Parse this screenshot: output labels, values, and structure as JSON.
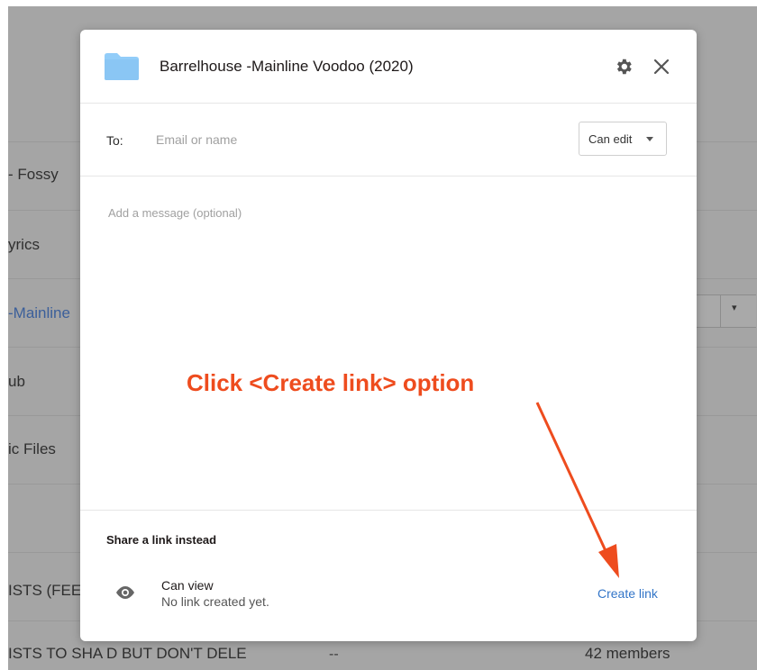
{
  "background": {
    "rows": [
      {
        "text": "- Fossy",
        "link": false
      },
      {
        "text": "yrics",
        "link": false
      },
      {
        "text": "-Mainline",
        "link": true
      },
      {
        "text": "ub",
        "link": false
      },
      {
        "text": "ic Files",
        "link": false
      },
      {
        "text": "",
        "link": false
      },
      {
        "text": "ISTS (FEE",
        "link": false
      },
      {
        "text": "ISTS TO SHA D BUT DON'T DELE",
        "link": false
      }
    ],
    "last_row_modified": "--",
    "last_row_members": "42 members",
    "dropdown_caret": "▾"
  },
  "dialog": {
    "title": "Barrelhouse -Mainline Voodoo (2020)",
    "to_label": "To:",
    "to_placeholder": "Email or name",
    "permission": "Can edit",
    "message_placeholder": "Add a message (optional)",
    "share_heading": "Share a link instead",
    "link_permission": "Can view",
    "link_status": "No link created yet.",
    "create_link_label": "Create link"
  },
  "annotation": {
    "text": "Click <Create link> option"
  },
  "colors": {
    "accent": "#3275c8",
    "annotation": "#ee4c1e",
    "folder": "#92cdf9",
    "overlay": "#a5a5a5"
  }
}
